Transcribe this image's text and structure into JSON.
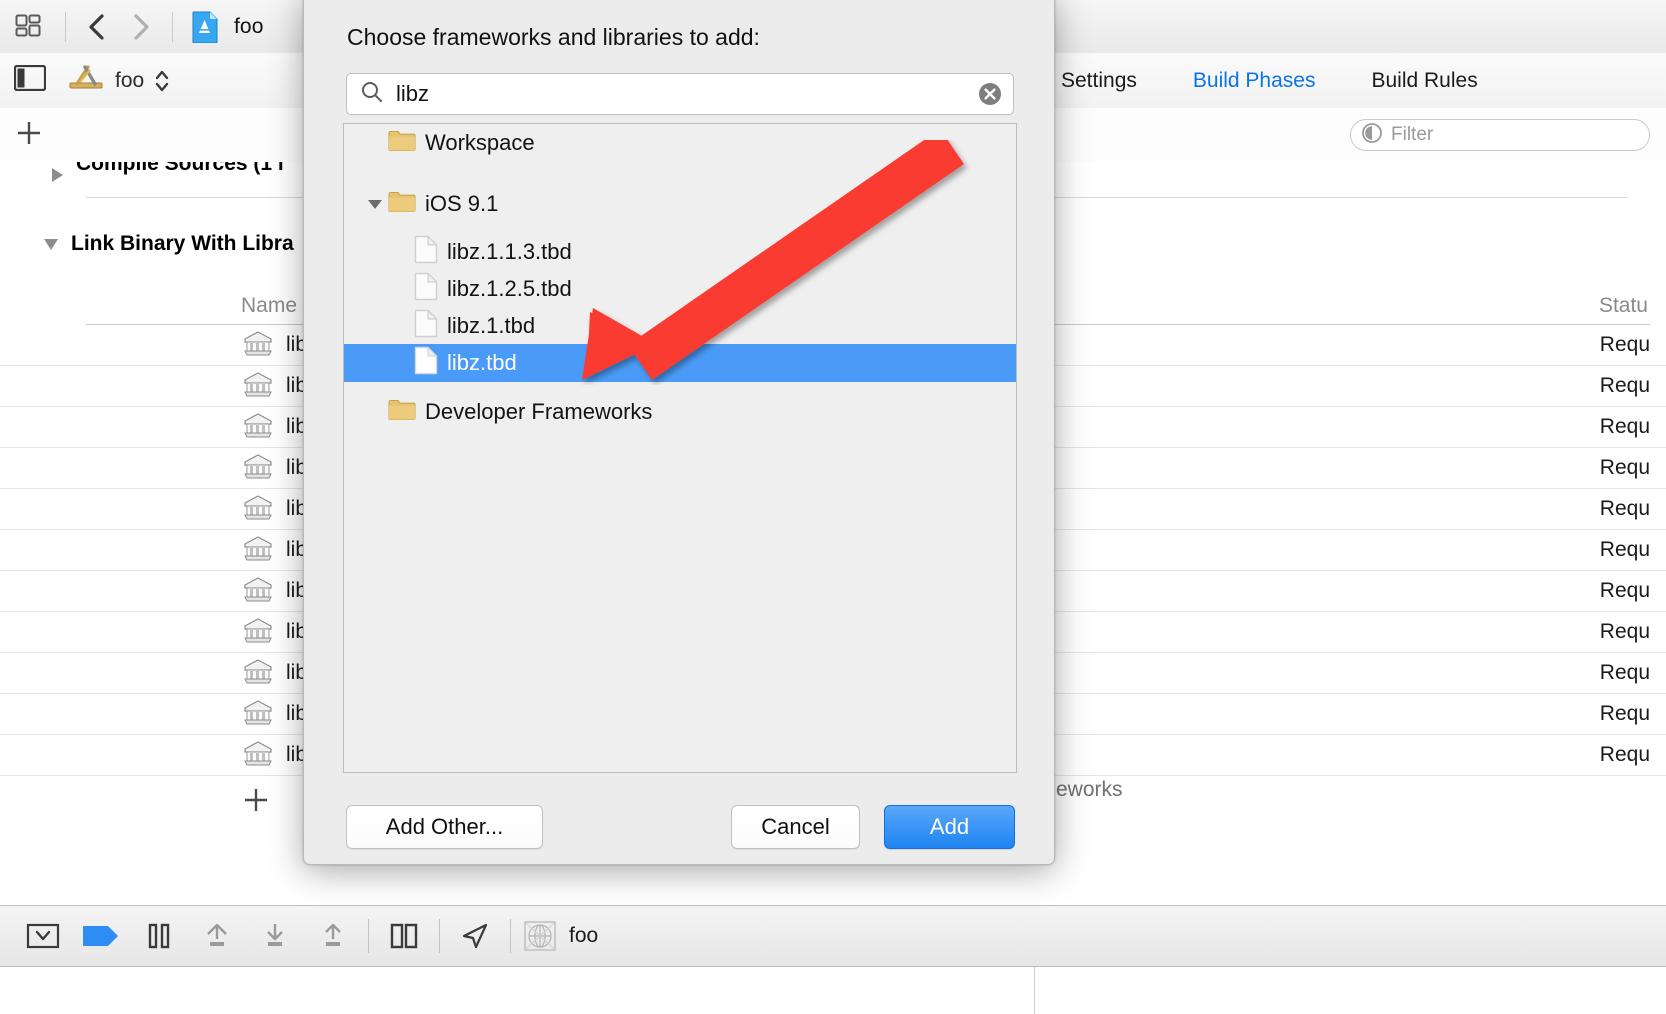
{
  "app": {
    "toolbar": {
      "project_name": "foo",
      "icons": [
        "navigator-toggle-icon",
        "back-chevron-icon",
        "forward-chevron-icon",
        "app-document-icon"
      ]
    },
    "jumpbar": {
      "target_name": "foo",
      "tabs": [
        {
          "label": "Settings",
          "active": false
        },
        {
          "label": "Build Phases",
          "active": true
        },
        {
          "label": "Build Rules",
          "active": false
        }
      ]
    },
    "filter": {
      "placeholder": "Filter"
    },
    "editor": {
      "phases": [
        {
          "label": "Compile Sources (1 i",
          "expanded": false
        },
        {
          "label": "Link Binary With Libra",
          "expanded": true
        }
      ],
      "table": {
        "columns": [
          "Name",
          "Statu"
        ],
        "rows": [
          {
            "name": "lib",
            "status": "Requ"
          },
          {
            "name": "lib",
            "status": "Requ"
          },
          {
            "name": "lib",
            "status": "Requ"
          },
          {
            "name": "lib",
            "status": "Requ"
          },
          {
            "name": "lib",
            "status": "Requ"
          },
          {
            "name": "lib",
            "status": "Requ"
          },
          {
            "name": "lib",
            "status": "Requ"
          },
          {
            "name": "lib",
            "status": "Requ"
          },
          {
            "name": "lib",
            "status": "Requ"
          },
          {
            "name": "lib",
            "status": "Requ"
          },
          {
            "name": "lib",
            "status": "Requ"
          }
        ]
      },
      "footnote": "eworks"
    },
    "bottombar": {
      "scheme_label": "foo",
      "icons": [
        "filter-toggle-icon",
        "breakpoint-icon",
        "pause-icon",
        "step-over-icon",
        "step-into-icon",
        "step-out-icon",
        "console-split-icon",
        "location-arrow-icon",
        "view-hierarchy-icon"
      ]
    }
  },
  "sheet": {
    "title": "Choose frameworks and libraries to add:",
    "search": {
      "value": "libz",
      "placeholder": "",
      "clear_label": "clear-search"
    },
    "list": [
      {
        "label": "Workspace",
        "kind": "folder",
        "indent": 0,
        "disclosure": "none",
        "selected": false
      },
      {
        "label": "iOS 9.1",
        "kind": "folder",
        "indent": 0,
        "disclosure": "down",
        "selected": false
      },
      {
        "label": "libz.1.1.3.tbd",
        "kind": "file",
        "indent": 1,
        "disclosure": "none",
        "selected": false
      },
      {
        "label": "libz.1.2.5.tbd",
        "kind": "file",
        "indent": 1,
        "disclosure": "none",
        "selected": false
      },
      {
        "label": "libz.1.tbd",
        "kind": "file",
        "indent": 1,
        "disclosure": "none",
        "selected": false
      },
      {
        "label": "libz.tbd",
        "kind": "file",
        "indent": 1,
        "disclosure": "none",
        "selected": true
      },
      {
        "label": "Developer Frameworks",
        "kind": "folder",
        "indent": 0,
        "disclosure": "none",
        "selected": false
      }
    ],
    "buttons": {
      "add_other": "Add Other...",
      "cancel": "Cancel",
      "add": "Add"
    }
  },
  "annotation": {
    "type": "arrow",
    "color": "#fa3b33",
    "points_to": "libz.tbd"
  },
  "colors": {
    "selection_blue": "#4a9bf7",
    "accent_link": "#0a74e8",
    "annotation_red": "#fa3b33",
    "primary_button": "#1f84f2",
    "folder_yellow": "#e8c濃"
  }
}
